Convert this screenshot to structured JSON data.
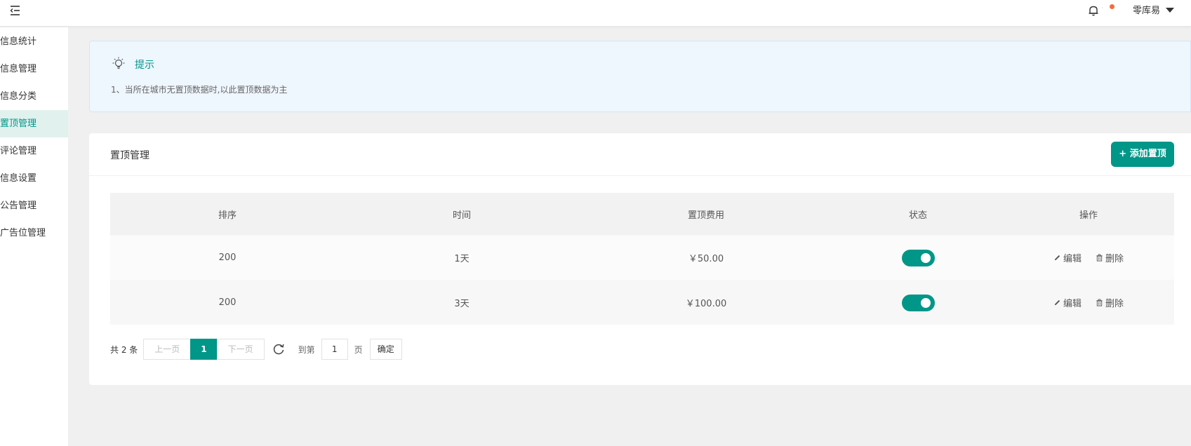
{
  "header": {
    "user_name": "零库易",
    "notify_sep": "·"
  },
  "sidebar": {
    "items": [
      {
        "label": "信息统计"
      },
      {
        "label": "信息管理"
      },
      {
        "label": "信息分类"
      },
      {
        "label": "置顶管理",
        "active": true
      },
      {
        "label": "评论管理"
      },
      {
        "label": "信息设置"
      },
      {
        "label": "公告管理"
      },
      {
        "label": "广告位管理"
      }
    ]
  },
  "tip": {
    "title": "提示",
    "text": "1、当所在城市无置顶数据时,以此置顶数据为主"
  },
  "card": {
    "title": "置顶管理",
    "add_button": "+ 添加置顶"
  },
  "table": {
    "headers": [
      "排序",
      "时间",
      "置顶费用",
      "状态",
      "操作"
    ],
    "rows": [
      {
        "sort": "200",
        "time": "1天",
        "fee": "￥50.00",
        "status": true
      },
      {
        "sort": "200",
        "time": "3天",
        "fee": "￥100.00",
        "status": true
      }
    ],
    "edit_label": "编辑",
    "delete_label": "删除"
  },
  "pagination": {
    "total": "共 2 条",
    "prev": "上一页",
    "current": "1",
    "next": "下一页",
    "goto_label": "到第",
    "page_value": "1",
    "page_unit": "页",
    "confirm": "确定"
  },
  "colors": {
    "accent": "#009688",
    "tip_bg": "#eef6fe",
    "notify_dot": "#f56c3c"
  }
}
